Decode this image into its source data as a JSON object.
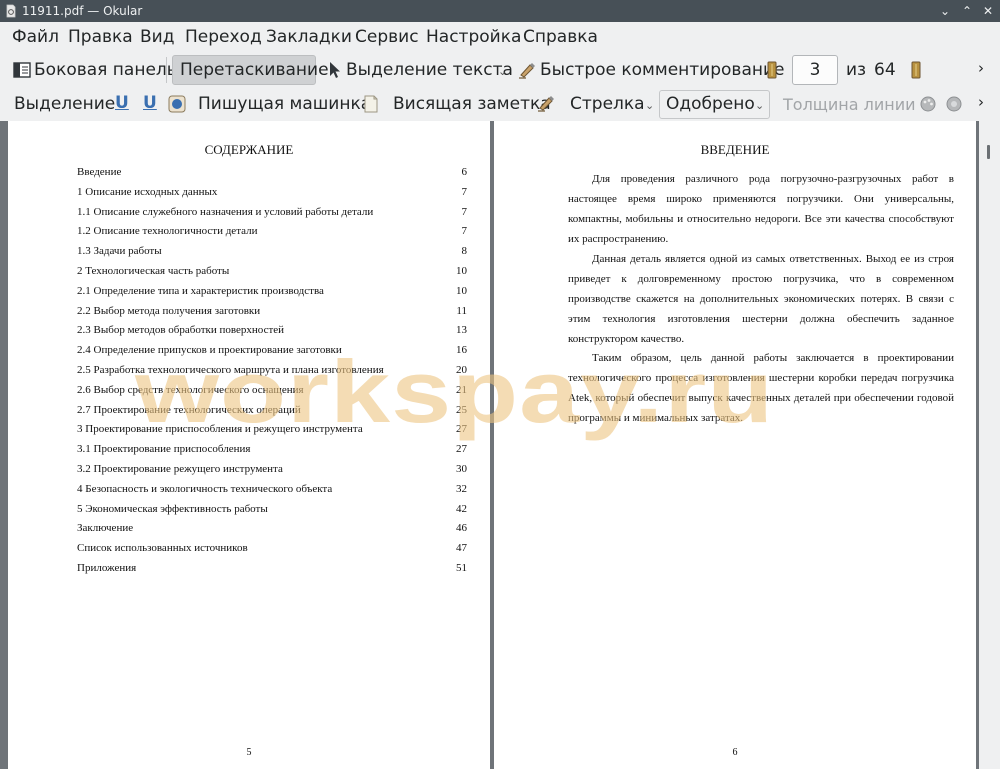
{
  "window": {
    "title": "11911.pdf  — Okular"
  },
  "menu": [
    "Файл",
    "Правка",
    "Вид",
    "Переход",
    "Закладки",
    "Сервис",
    "Настройка",
    "Справка"
  ],
  "toolbar1": {
    "sidebar": "Боковая панель",
    "drag": "Перетаскивание",
    "text_select": "Выделение текста",
    "quick_comment": "Быстрое комментирование",
    "page_current": "3",
    "page_of": "из",
    "page_total": "64"
  },
  "toolbar2": {
    "highlight": "Выделение",
    "typewriter": "Пишущая машинка",
    "pinned_note": "Висящая заметка",
    "arrow": "Стрелка",
    "stamp": "Одобрено",
    "line_width": "Толщина линии"
  },
  "page_left": {
    "heading": "СОДЕРЖАНИЕ",
    "toc": [
      {
        "title": "Введение",
        "page": "6"
      },
      {
        "title": "1 Описание исходных данных",
        "page": "7"
      },
      {
        "title": "1.1 Описание служебного назначения и условий работы детали",
        "page": "7"
      },
      {
        "title": "1.2 Описание технологичности детали",
        "page": "7"
      },
      {
        "title": "1.3 Задачи работы",
        "page": "8"
      },
      {
        "title": "2 Технологическая часть работы",
        "page": "10"
      },
      {
        "title": "2.1 Определение типа и характеристик производства",
        "page": "10"
      },
      {
        "title": "2.2 Выбор метода получения заготовки",
        "page": "11"
      },
      {
        "title": "2.3 Выбор методов обработки поверхностей",
        "page": "13"
      },
      {
        "title": "2.4 Определение припусков и проектирование заготовки",
        "page": "16"
      },
      {
        "title": "2.5 Разработка технологического маршрута и плана изготовления",
        "page": "20"
      },
      {
        "title": "2.6 Выбор средств технологического оснащения",
        "page": "21"
      },
      {
        "title": "2.7 Проектирование технологических операций",
        "page": "25"
      },
      {
        "title": "3 Проектирование приспособления и режущего инструмента",
        "page": "27"
      },
      {
        "title": "3.1 Проектирование приспособления",
        "page": "27"
      },
      {
        "title": "3.2 Проектирование режущего инструмента",
        "page": "30"
      },
      {
        "title": "4 Безопасность и экологичность технического объекта",
        "page": "32"
      },
      {
        "title": "5 Экономическая эффективность работы",
        "page": "42"
      },
      {
        "title": "Заключение",
        "page": "46"
      },
      {
        "title": "Список использованных источников",
        "page": "47"
      },
      {
        "title": "Приложения",
        "page": "51"
      }
    ],
    "page_number": "5"
  },
  "page_right": {
    "heading": "ВВЕДЕНИЕ",
    "paragraphs": [
      "Для проведения различного рода погрузочно-разгрузочных работ в настоящее время широко применяются погрузчики. Они универсальны, компактны, мобильны и относительно недороги. Все эти качества способствуют их распространению.",
      "Данная деталь является одной из самых ответственных. Выход ее из строя приведет к долговременному простою погрузчика, что в современном производстве скажется на дополнительных экономических потерях. В связи с этим технология изготовления шестерни должна обеспечить заданное конструктором качество.",
      "Таким образом, цель данной работы заключается в проектировании технологического процесса изготовления шестерни коробки передач погрузчика Atek, который обеспечит выпуск качественных деталей при обеспечении годовой программы и минимальных затратах."
    ],
    "page_number": "6"
  },
  "watermark": "workspay.ru"
}
